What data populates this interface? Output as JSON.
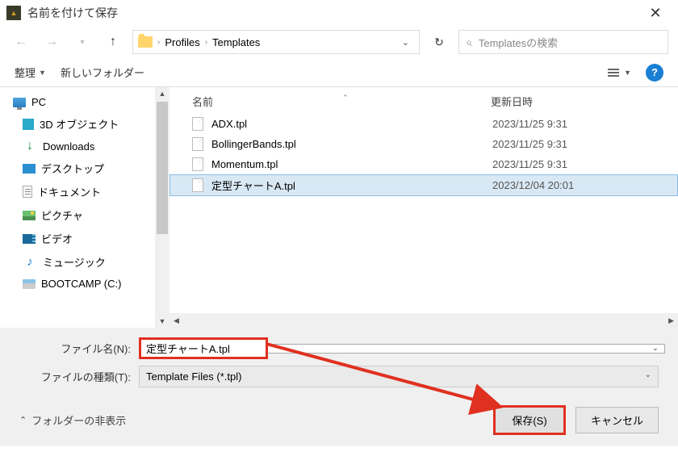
{
  "titlebar": {
    "title": "名前を付けて保存"
  },
  "nav": {
    "path": {
      "crumb1": "Profiles",
      "crumb2": "Templates"
    },
    "search_placeholder": "Templatesの検索"
  },
  "toolbar": {
    "organize": "整理",
    "newfolder": "新しいフォルダー"
  },
  "sidebar": {
    "pc": "PC",
    "items": [
      "3D オブジェクト",
      "Downloads",
      "デスクトップ",
      "ドキュメント",
      "ピクチャ",
      "ビデオ",
      "ミュージック",
      "BOOTCAMP (C:)"
    ]
  },
  "columns": {
    "name": "名前",
    "date": "更新日時"
  },
  "files": [
    {
      "name": "ADX.tpl",
      "date": "2023/11/25 9:31"
    },
    {
      "name": "BollingerBands.tpl",
      "date": "2023/11/25 9:31"
    },
    {
      "name": "Momentum.tpl",
      "date": "2023/11/25 9:31"
    },
    {
      "name": "定型チャートA.tpl",
      "date": "2023/12/04 20:01"
    }
  ],
  "form": {
    "filename_label": "ファイル名(N):",
    "filename_value": "定型チャートA.tpl",
    "filetype_label": "ファイルの種類(T):",
    "filetype_value": "Template Files (*.tpl)"
  },
  "footer": {
    "hide_folders": "フォルダーの非表示",
    "save": "保存(S)",
    "cancel": "キャンセル"
  }
}
